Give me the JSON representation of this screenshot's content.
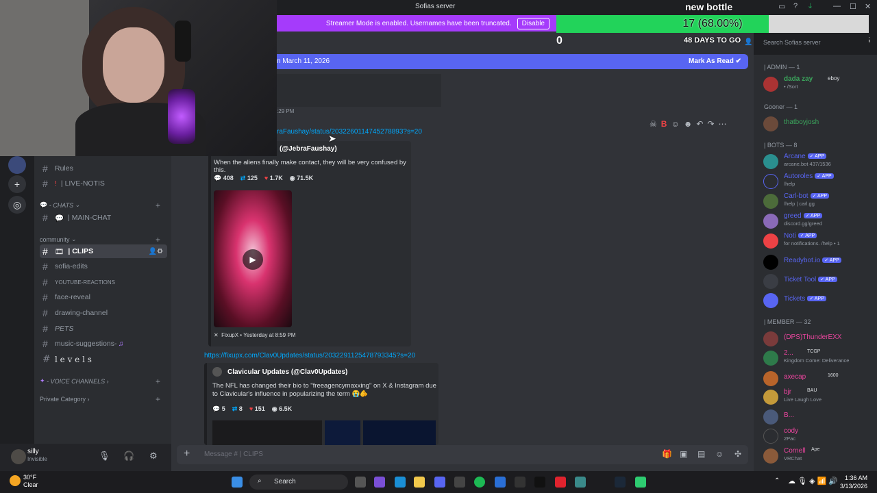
{
  "window": {
    "title": "Sofias server",
    "minimize": "—",
    "maximize": "☐",
    "close": "✕"
  },
  "banner": {
    "text": "Streamer Mode is enabled. Usernames have been truncated.",
    "disable": "Disable"
  },
  "goal": {
    "title": "new bottle",
    "progress": 0.68,
    "label": "17 (68.00%)",
    "min": "0",
    "max": "25",
    "days": "48 DAYS TO GO"
  },
  "header": {
    "search_placeholder": "Search Sofias server"
  },
  "new_messages_bar": {
    "text": "n March 11, 2026",
    "mark_read": "Mark As Read"
  },
  "channels": [
    {
      "label": "Rules",
      "active": false
    },
    {
      "label": "| LIVE-NOTIS",
      "active": false
    },
    {
      "label": "| MAIN-CHAT",
      "active": false
    },
    {
      "label": "| CLIPS",
      "active": true
    },
    {
      "label": "sofia-edits",
      "active": false
    },
    {
      "label": "YOUTUBE-REACTIONS",
      "active": false
    },
    {
      "label": "face-reveal",
      "active": false
    },
    {
      "label": "drawing-channel",
      "active": false
    },
    {
      "label": "PETS",
      "active": false
    },
    {
      "label": "music-suggestions-",
      "active": false
    },
    {
      "label": "l e v e l s",
      "active": false
    }
  ],
  "categories": {
    "chats": "- CHATS",
    "community": "community",
    "voice": "- VOICE CHANNELS",
    "private": "Private Category"
  },
  "user": {
    "name": "silly",
    "status": "Invisible"
  },
  "messages": {
    "time1": ":29 PM",
    "link1": "raFaushay/status/2032260114745278893?s=20",
    "embed1": {
      "author": "(@JebraFaushay)",
      "desc": "When the aliens finally make contact, they will be very confused by this.",
      "replies": "408",
      "retweets": "125",
      "likes": "1.7K",
      "views": "71.5K",
      "footer": "FixupX • Yesterday at 8:59 PM"
    },
    "link2": "https://fixupx.com/Clav0Updates/status/2032291125478793345?s=20",
    "embed2": {
      "author": "Clavicular Updates (@Clav0Updates)",
      "desc": "The NFL has changed their bio to \"freeagencymaxxing\" on X & Instagram due to Clavicular's influence in popularizing the term 😭🫵",
      "replies": "5",
      "retweets": "8",
      "likes": "151",
      "views": "6.5K"
    }
  },
  "composer": {
    "placeholder": "Message # | CLIPS"
  },
  "members": {
    "admin_header": "| ADMIN — 1",
    "gooner_header": "Gooner — 1",
    "bots_header": "| BOTS — 8",
    "member_header": "| MEMBER — 32",
    "admin": [
      {
        "name": "dada zay",
        "sub": "• /Sort",
        "tag": "eboy",
        "color": "#3ba55c"
      }
    ],
    "gooner": [
      {
        "name": "thatboyjosh",
        "sub": "",
        "color": "#3ba55c"
      }
    ],
    "bots": [
      {
        "name": "Arcane",
        "sub": "arcane.bot 437/1536",
        "color": "#5865f2"
      },
      {
        "name": "Autoroles",
        "sub": "/help",
        "color": "#5865f2"
      },
      {
        "name": "Carl-bot",
        "sub": "/help | carl.gg",
        "color": "#5865f2"
      },
      {
        "name": "greed",
        "sub": "discord.gg/greed",
        "color": "#5865f2"
      },
      {
        "name": "Noti",
        "sub": "for notifications. /help • 1",
        "color": "#5865f2"
      },
      {
        "name": "Readybot.io",
        "sub": "",
        "color": "#5865f2"
      },
      {
        "name": "Ticket Tool",
        "sub": "",
        "color": "#5865f2"
      },
      {
        "name": "Tickets",
        "sub": "",
        "color": "#5865f2"
      }
    ],
    "app_badge": "✓ APP",
    "members": [
      {
        "name": "(DPS)ThunderEXX",
        "sub": "",
        "color": "#eb459e"
      },
      {
        "name": "2...",
        "sub": "Kingdom Come: Deliverance",
        "tag": "TCGP",
        "color": "#eb459e"
      },
      {
        "name": "axecap",
        "sub": "",
        "tag": "1600",
        "color": "#eb459e"
      },
      {
        "name": "bjr",
        "sub": "Live Laugh Love",
        "tag": "BAU",
        "color": "#eb459e"
      },
      {
        "name": "B...",
        "sub": "",
        "color": "#eb459e"
      },
      {
        "name": "cody",
        "sub": "2Pac",
        "color": "#eb459e"
      },
      {
        "name": "Cornell",
        "sub": "VRChat",
        "tag": "Ape",
        "color": "#eb459e"
      }
    ]
  },
  "taskbar": {
    "temp": "30°F",
    "condition": "Clear",
    "search": "Search",
    "time": "1:36 AM",
    "date": "3/13/2026"
  }
}
